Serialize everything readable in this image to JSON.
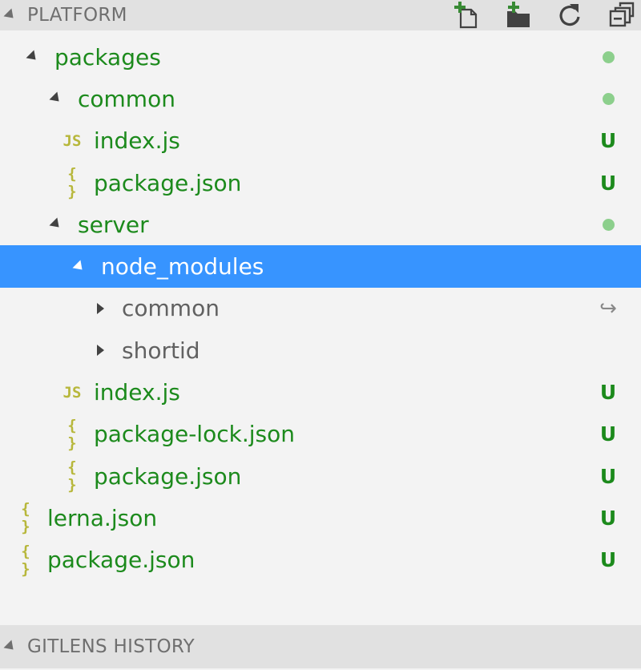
{
  "explorer": {
    "title": "PLATFORM",
    "toolbar": {
      "new_file_icon": "new-file-icon",
      "new_folder_icon": "new-folder-icon",
      "refresh_icon": "refresh-icon",
      "collapse_all_icon": "collapse-all-icon"
    },
    "tree": [
      {
        "label": "packages",
        "kind": "folder",
        "expanded": true,
        "depth": 0,
        "decoration": "dot"
      },
      {
        "label": "common",
        "kind": "folder",
        "expanded": true,
        "depth": 1,
        "decoration": "dot"
      },
      {
        "label": "index.js",
        "kind": "js",
        "depth": 2,
        "decoration": "U"
      },
      {
        "label": "package.json",
        "kind": "json",
        "depth": 2,
        "decoration": "U"
      },
      {
        "label": "server",
        "kind": "folder",
        "expanded": true,
        "depth": 1,
        "decoration": "dot"
      },
      {
        "label": "node_modules",
        "kind": "folder",
        "expanded": true,
        "depth": 2,
        "selected": true
      },
      {
        "label": "common",
        "kind": "folder",
        "expanded": false,
        "depth": 3,
        "decoration": "symlink-arrow-icon"
      },
      {
        "label": "shortid",
        "kind": "folder",
        "expanded": false,
        "depth": 3
      },
      {
        "label": "index.js",
        "kind": "js",
        "depth": 2,
        "decoration": "U"
      },
      {
        "label": "package-lock.json",
        "kind": "json",
        "depth": 2,
        "decoration": "U"
      },
      {
        "label": "package.json",
        "kind": "json",
        "depth": 2,
        "decoration": "U"
      },
      {
        "label": "lerna.json",
        "kind": "json",
        "depth": 0,
        "decoration": "U"
      },
      {
        "label": "package.json",
        "kind": "json",
        "depth": 0,
        "decoration": "U"
      }
    ],
    "icons": {
      "js": "JS",
      "json": "{ }"
    },
    "badge_untracked": "U"
  },
  "gitlens": {
    "title": "GITLENS HISTORY"
  },
  "colors": {
    "selection": "#3794ff",
    "git_untracked": "#1c8a1c",
    "modified_dot": "#8ccf8c",
    "file_icon": "#b7b73b"
  }
}
